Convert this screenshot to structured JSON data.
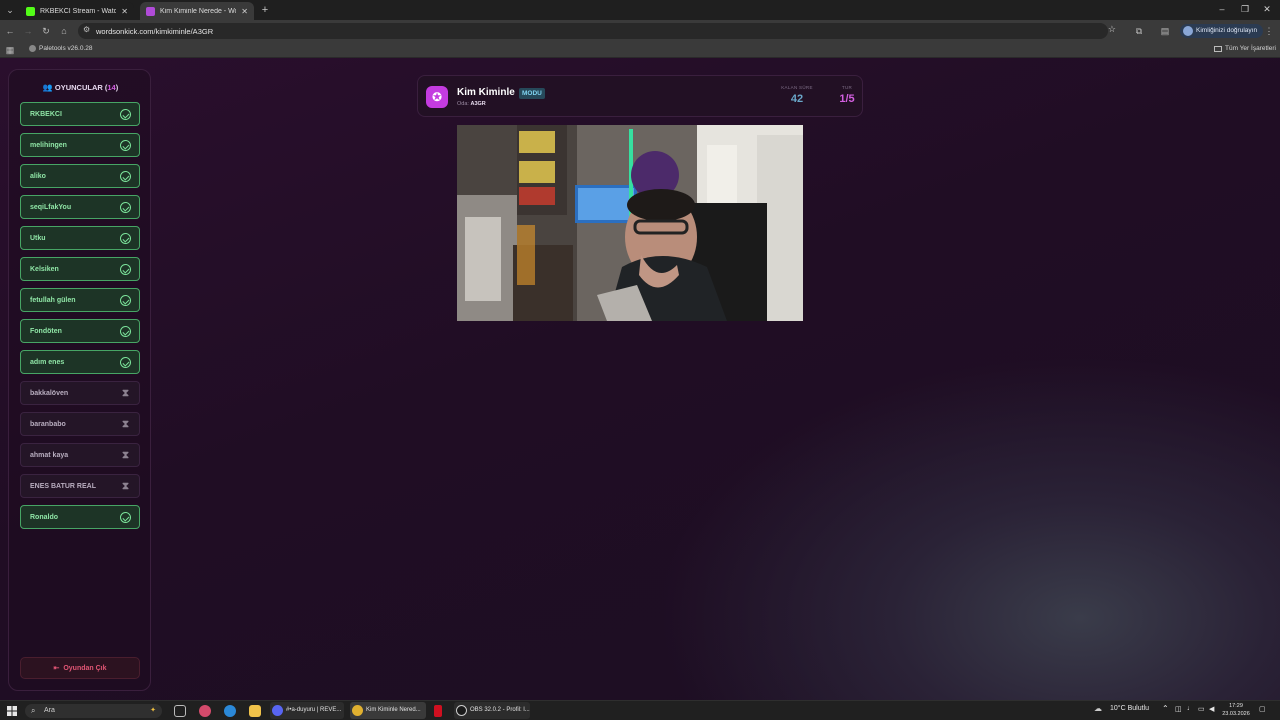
{
  "browser": {
    "tabs": [
      {
        "title": "RKBEKCI Stream - Watch Live o",
        "active": false
      },
      {
        "title": "Kim Kiminle Nerede - Words O",
        "active": true
      }
    ],
    "url": "wordsonkick.com/kimkiminle/A3GR",
    "profile_label": "Kimliğinizi doğrulayın",
    "bookmarks": {
      "left": "Paletools v26.0.28",
      "right": "Tüm Yer İşaretleri"
    }
  },
  "sidebar": {
    "title": "OYUNCULAR",
    "count": "14",
    "players": [
      {
        "name": "RKBEKCI",
        "status": "ready"
      },
      {
        "name": "melihingen",
        "status": "ready"
      },
      {
        "name": "aliko",
        "status": "ready"
      },
      {
        "name": "seqiLfakYou",
        "status": "ready"
      },
      {
        "name": "Utku",
        "status": "ready"
      },
      {
        "name": "Kelsiken",
        "status": "ready"
      },
      {
        "name": "fetullah gülen",
        "status": "ready"
      },
      {
        "name": "Fondöten",
        "status": "ready"
      },
      {
        "name": "adım enes",
        "status": "ready"
      },
      {
        "name": "bakkalöven",
        "status": "waiting"
      },
      {
        "name": "baranbabo",
        "status": "waiting"
      },
      {
        "name": "ahmat kaya",
        "status": "waiting"
      },
      {
        "name": "ENES BATUR REAL",
        "status": "waiting"
      },
      {
        "name": "Ronaldo",
        "status": "ready"
      }
    ],
    "leave_label": "Oyundan Çık"
  },
  "game": {
    "title": "Kim Kiminle",
    "mode_badge": "MODU",
    "room_label": "Oda:",
    "room_code": "A3GR",
    "time_label": "KALAN SÜRE",
    "time_value": "42",
    "round_label": "TUR",
    "round_value": "1/5",
    "colors": {
      "accent": "#c43be0",
      "time": "#6aa7c9",
      "round": "#d35fe0",
      "ready": "#7be39a"
    }
  },
  "taskbar": {
    "search_placeholder": "Ara",
    "apps": [
      "#•a-duyuru | REVE...",
      "Kim Kiminle Nered...",
      "OBS 32.0.2 - Profil: l..."
    ],
    "weather": "10°C  Bulutlu",
    "time": "17:29",
    "date": "23.03.2026"
  }
}
